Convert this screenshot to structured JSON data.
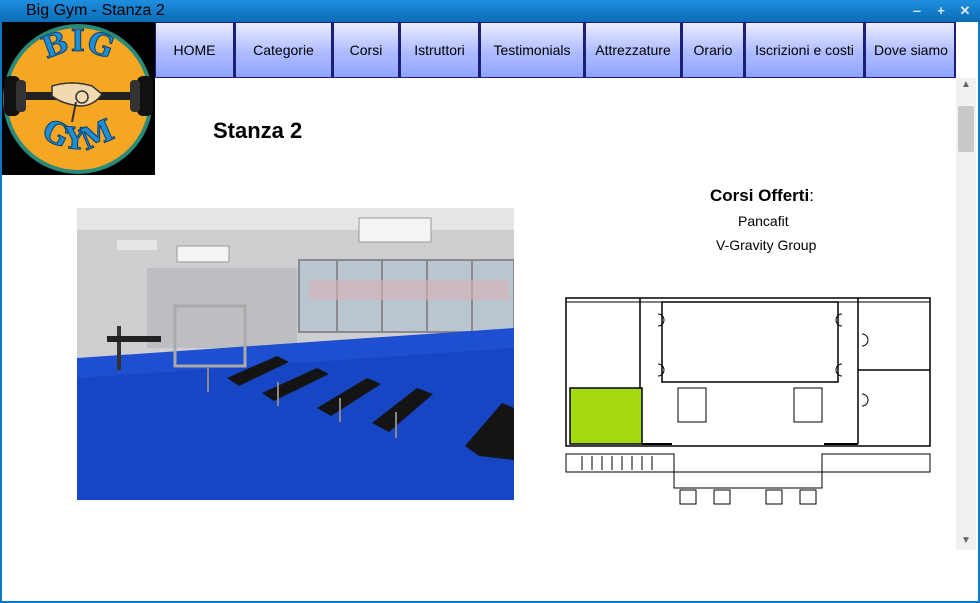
{
  "window": {
    "title": "Big Gym - Stanza 2",
    "controls": {
      "minimize": "‒",
      "maximize": "+",
      "close": "✕"
    }
  },
  "logo": {
    "top_text": "BIG",
    "bottom_text": "GYM"
  },
  "nav": {
    "items": [
      "HOME",
      "Categorie",
      "Corsi",
      "Istruttori",
      "Testimonials",
      "Attrezzature",
      "Orario",
      "Iscrizioni e costi",
      "Dove siamo"
    ]
  },
  "page": {
    "title": "Stanza 2"
  },
  "courses": {
    "heading": "Corsi Offerti",
    "heading_suffix": ":",
    "items": [
      "Pancafit",
      "V-Gravity Group"
    ]
  },
  "floorplan": {
    "highlight_color": "#a6d812"
  },
  "scrollbar": {
    "up": "▲",
    "down": "▼"
  }
}
